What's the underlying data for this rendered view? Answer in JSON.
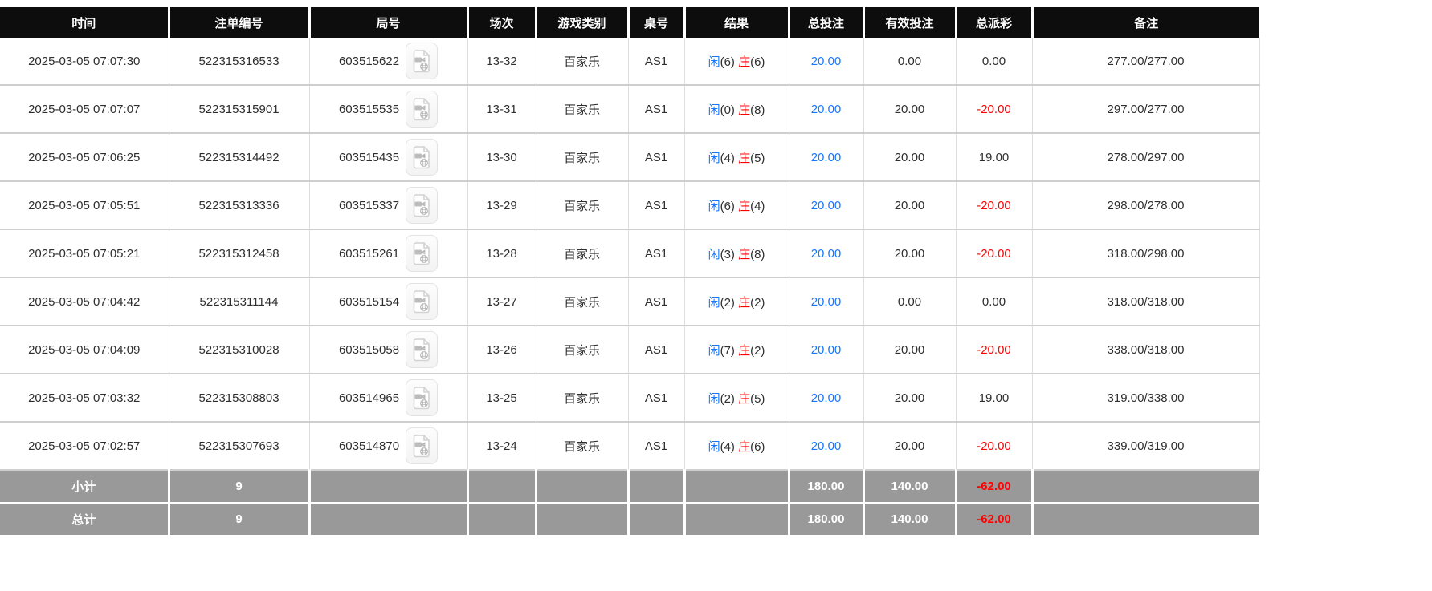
{
  "table": {
    "columns": [
      {
        "key": "time",
        "label": "时间"
      },
      {
        "key": "bet_id",
        "label": "注单编号"
      },
      {
        "key": "round_id",
        "label": "局号"
      },
      {
        "key": "session",
        "label": "场次"
      },
      {
        "key": "game_type",
        "label": "游戏类别"
      },
      {
        "key": "table_no",
        "label": "桌号"
      },
      {
        "key": "result",
        "label": "结果"
      },
      {
        "key": "total_bet",
        "label": "总投注"
      },
      {
        "key": "valid_bet",
        "label": "有效投注"
      },
      {
        "key": "total_payout",
        "label": "总派彩"
      },
      {
        "key": "remark",
        "label": "备注"
      }
    ],
    "result_labels": {
      "player": "闲",
      "banker": "庄"
    },
    "rows": [
      {
        "time": "2025-03-05 07:07:30",
        "bet_id": "522315316533",
        "round_id": "603515622",
        "session": "13-32",
        "game_type": "百家乐",
        "table_no": "AS1",
        "result": {
          "player": "6",
          "banker": "6"
        },
        "total_bet": "20.00",
        "valid_bet": "0.00",
        "total_payout": "0.00",
        "remark": "277.00/277.00"
      },
      {
        "time": "2025-03-05 07:07:07",
        "bet_id": "522315315901",
        "round_id": "603515535",
        "session": "13-31",
        "game_type": "百家乐",
        "table_no": "AS1",
        "result": {
          "player": "0",
          "banker": "8"
        },
        "total_bet": "20.00",
        "valid_bet": "20.00",
        "total_payout": "-20.00",
        "remark": "297.00/277.00"
      },
      {
        "time": "2025-03-05 07:06:25",
        "bet_id": "522315314492",
        "round_id": "603515435",
        "session": "13-30",
        "game_type": "百家乐",
        "table_no": "AS1",
        "result": {
          "player": "4",
          "banker": "5"
        },
        "total_bet": "20.00",
        "valid_bet": "20.00",
        "total_payout": "19.00",
        "remark": "278.00/297.00"
      },
      {
        "time": "2025-03-05 07:05:51",
        "bet_id": "522315313336",
        "round_id": "603515337",
        "session": "13-29",
        "game_type": "百家乐",
        "table_no": "AS1",
        "result": {
          "player": "6",
          "banker": "4"
        },
        "total_bet": "20.00",
        "valid_bet": "20.00",
        "total_payout": "-20.00",
        "remark": "298.00/278.00"
      },
      {
        "time": "2025-03-05 07:05:21",
        "bet_id": "522315312458",
        "round_id": "603515261",
        "session": "13-28",
        "game_type": "百家乐",
        "table_no": "AS1",
        "result": {
          "player": "3",
          "banker": "8"
        },
        "total_bet": "20.00",
        "valid_bet": "20.00",
        "total_payout": "-20.00",
        "remark": "318.00/298.00"
      },
      {
        "time": "2025-03-05 07:04:42",
        "bet_id": "522315311144",
        "round_id": "603515154",
        "session": "13-27",
        "game_type": "百家乐",
        "table_no": "AS1",
        "result": {
          "player": "2",
          "banker": "2"
        },
        "total_bet": "20.00",
        "valid_bet": "0.00",
        "total_payout": "0.00",
        "remark": "318.00/318.00"
      },
      {
        "time": "2025-03-05 07:04:09",
        "bet_id": "522315310028",
        "round_id": "603515058",
        "session": "13-26",
        "game_type": "百家乐",
        "table_no": "AS1",
        "result": {
          "player": "7",
          "banker": "2"
        },
        "total_bet": "20.00",
        "valid_bet": "20.00",
        "total_payout": "-20.00",
        "remark": "338.00/318.00"
      },
      {
        "time": "2025-03-05 07:03:32",
        "bet_id": "522315308803",
        "round_id": "603514965",
        "session": "13-25",
        "game_type": "百家乐",
        "table_no": "AS1",
        "result": {
          "player": "2",
          "banker": "5"
        },
        "total_bet": "20.00",
        "valid_bet": "20.00",
        "total_payout": "19.00",
        "remark": "319.00/338.00"
      },
      {
        "time": "2025-03-05 07:02:57",
        "bet_id": "522315307693",
        "round_id": "603514870",
        "session": "13-24",
        "game_type": "百家乐",
        "table_no": "AS1",
        "result": {
          "player": "4",
          "banker": "6"
        },
        "total_bet": "20.00",
        "valid_bet": "20.00",
        "total_payout": "-20.00",
        "remark": "339.00/319.00"
      }
    ],
    "subtotal": {
      "label": "小计",
      "count": "9",
      "total_bet": "180.00",
      "valid_bet": "140.00",
      "total_payout": "-62.00"
    },
    "grand_total": {
      "label": "总计",
      "count": "9",
      "total_bet": "180.00",
      "valid_bet": "140.00",
      "total_payout": "-62.00"
    }
  },
  "icons": {
    "video_replay": "film-document-icon"
  },
  "colors": {
    "header_bg": "#0d0d0d",
    "header_text": "#ffffff",
    "footer_bg": "#999999",
    "accent_blue": "#1677ff",
    "banker_red": "#ff0000",
    "negative_red": "#ff0000",
    "row_border": "#cfcfcf"
  }
}
